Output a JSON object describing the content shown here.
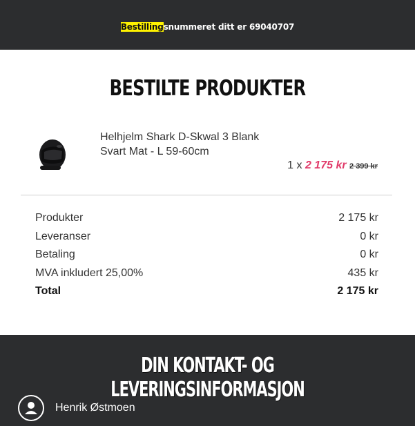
{
  "header": {
    "order_highlight": "Bestilling",
    "order_rest": "snummeret ditt er 69040707"
  },
  "products": {
    "title": "BESTILTE PRODUKTER",
    "items": [
      {
        "name": "Helhjelm Shark D-Skwal 3 Blank Svart Mat - L 59-60cm",
        "quantity_prefix": "1 x",
        "price": "2 175 kr",
        "old_price": "2 399 kr",
        "image_icon": "helmet-icon"
      }
    ]
  },
  "summary": {
    "rows": [
      {
        "label": "Produkter",
        "value": "2 175 kr"
      },
      {
        "label": "Leveranser",
        "value": "0 kr"
      },
      {
        "label": "Betaling",
        "value": "0 kr"
      },
      {
        "label": "MVA inkludert 25,00%",
        "value": "435 kr"
      }
    ],
    "total": {
      "label": "Total",
      "value": "2 175 kr"
    }
  },
  "contact": {
    "title": "DIN KONTAKT- OG LEVERINGSINFORMASJON",
    "name": "Henrik Østmoen",
    "avatar_icon": "user-icon"
  },
  "colors": {
    "dark_panel": "#2c2d2f",
    "highlight": "#fff200",
    "sale_price": "#e13b6a"
  }
}
